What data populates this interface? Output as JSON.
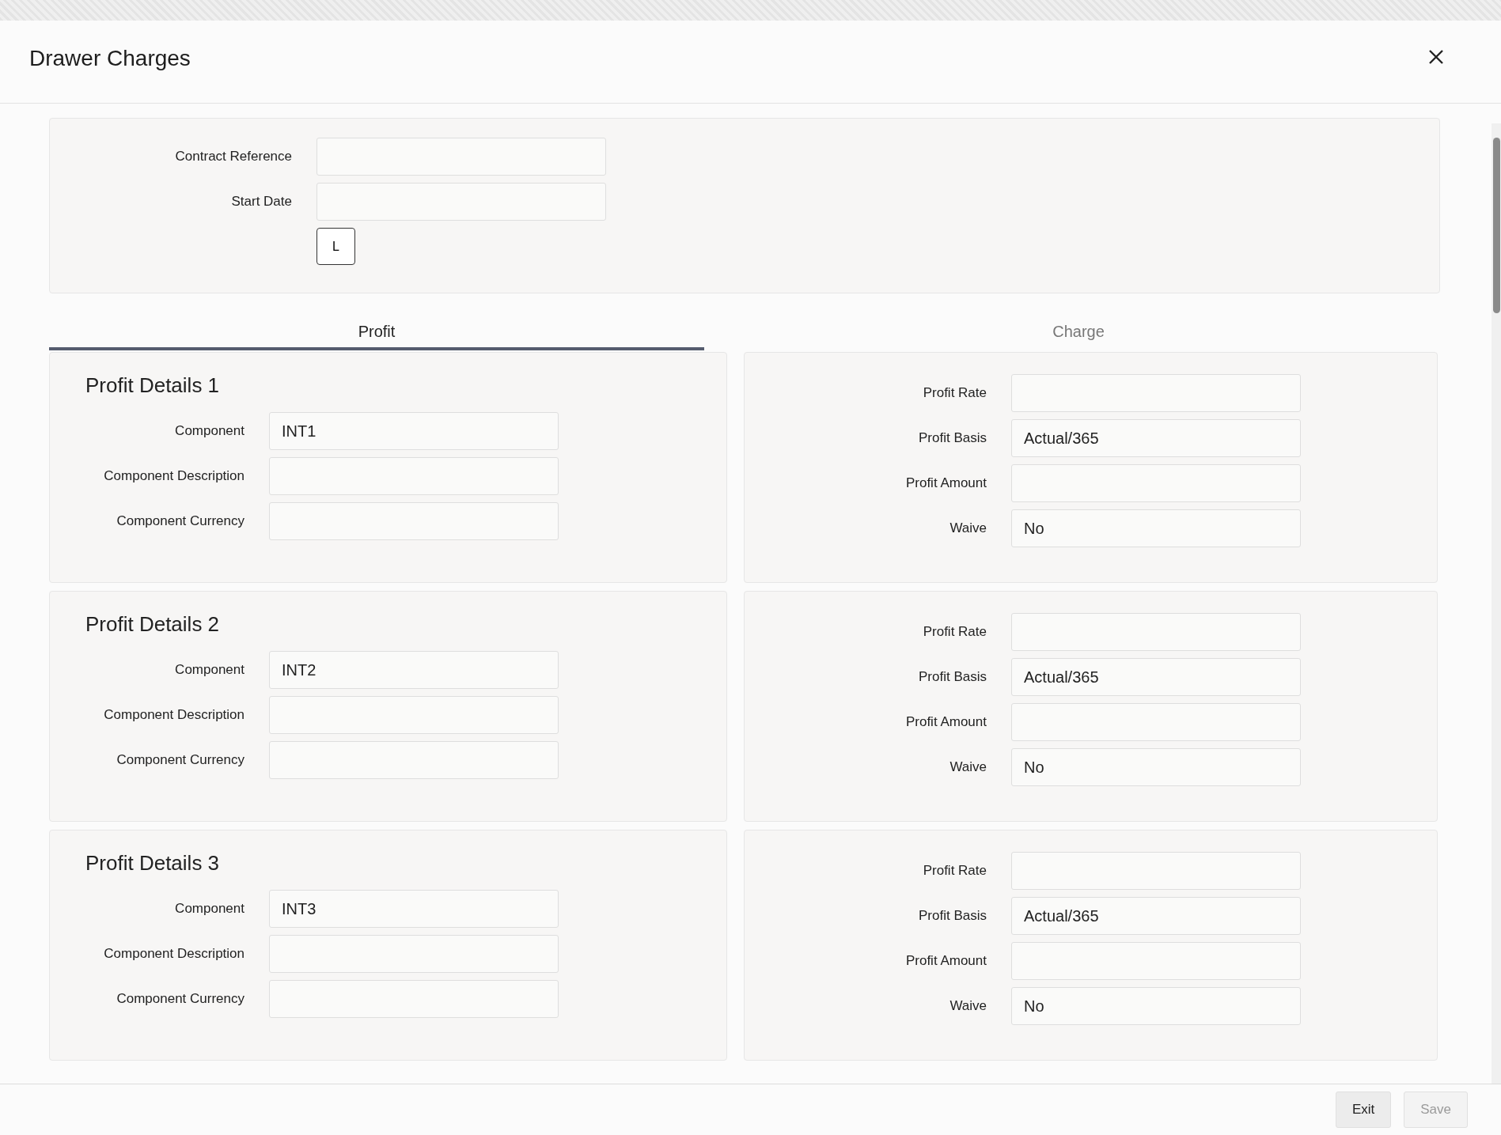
{
  "window": {
    "title": "Drawer Charges"
  },
  "header_fields": [
    {
      "label": "Contract Reference"
    },
    {
      "label": "Start Date"
    }
  ],
  "lookup_button": "L",
  "tabs": [
    {
      "label": "Profit",
      "selected": true
    },
    {
      "label": "Charge",
      "selected": false
    }
  ],
  "profit_details": [
    {
      "title": "Profit Details 1",
      "fields": [
        {
          "label": "Component",
          "value": "INT1"
        },
        {
          "label": "Component Description"
        },
        {
          "label": "Component Currency"
        }
      ],
      "rate_fields": [
        {
          "label": "Profit Rate"
        },
        {
          "label": "Profit Basis",
          "value": "Actual/365"
        },
        {
          "label": "Profit Amount"
        },
        {
          "label": "Waive",
          "value": "No"
        }
      ]
    },
    {
      "title": "Profit Details 2",
      "fields": [
        {
          "label": "Component",
          "value": "INT2"
        },
        {
          "label": "Component Description"
        },
        {
          "label": "Component Currency"
        }
      ],
      "rate_fields": [
        {
          "label": "Profit Rate"
        },
        {
          "label": "Profit Basis",
          "value": "Actual/365"
        },
        {
          "label": "Profit Amount"
        },
        {
          "label": "Waive",
          "value": "No"
        }
      ]
    },
    {
      "title": "Profit Details 3",
      "fields": [
        {
          "label": "Component",
          "value": "INT3"
        },
        {
          "label": "Component Description"
        },
        {
          "label": "Component Currency"
        }
      ],
      "rate_fields": [
        {
          "label": "Profit Rate"
        },
        {
          "label": "Profit Basis",
          "value": "Actual/365"
        },
        {
          "label": "Profit Amount"
        },
        {
          "label": "Waive",
          "value": "No"
        }
      ]
    }
  ],
  "buttons": [
    {
      "label": "Exit",
      "disabled": false
    },
    {
      "label": "Save",
      "disabled": true
    }
  ]
}
